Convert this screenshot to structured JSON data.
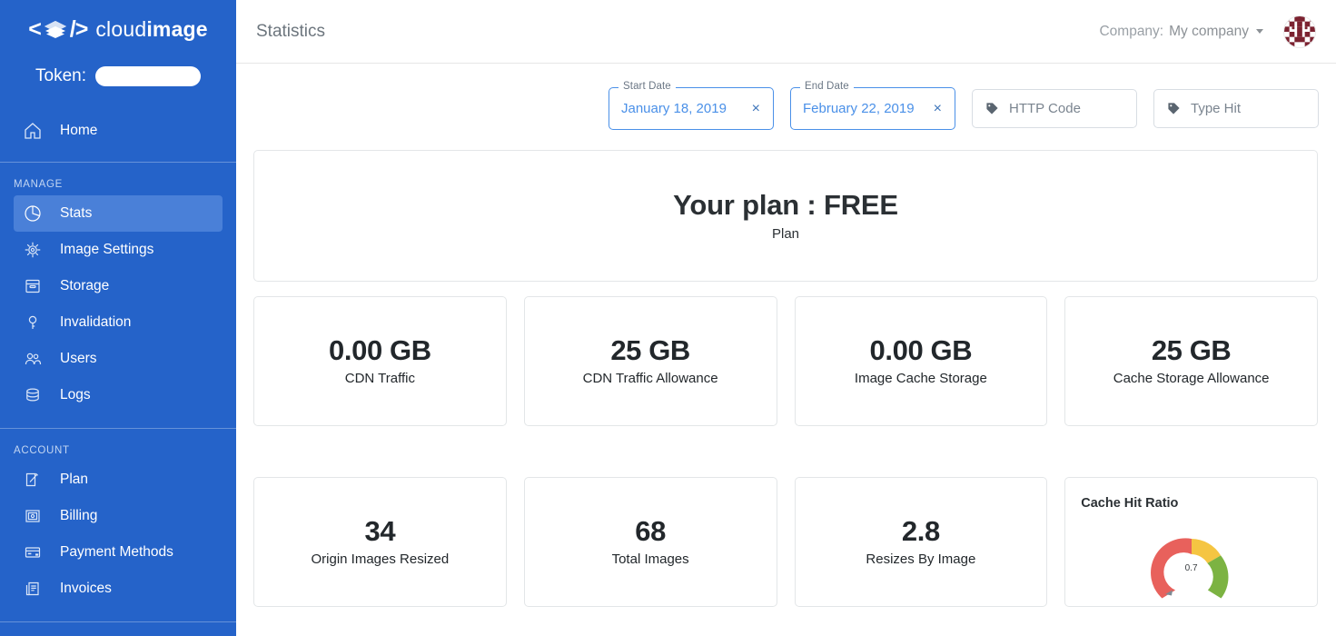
{
  "sidebar": {
    "brand": {
      "angle_open": "<",
      "angle_close": "/>",
      "name_light": "cloud",
      "name_bold": "image",
      "icon": "layers-icon"
    },
    "token": {
      "label": "Token:",
      "value": ""
    },
    "home": {
      "label": "Home",
      "icon": "home-icon"
    },
    "groups": [
      {
        "label": "MANAGE",
        "items": [
          {
            "label": "Stats",
            "icon": "pie-chart-icon",
            "active": true
          },
          {
            "label": "Image Settings",
            "icon": "gear-icon",
            "active": false
          },
          {
            "label": "Storage",
            "icon": "box-icon",
            "active": false
          },
          {
            "label": "Invalidation",
            "icon": "key-icon",
            "active": false
          },
          {
            "label": "Users",
            "icon": "users-icon",
            "active": false
          },
          {
            "label": "Logs",
            "icon": "database-icon",
            "active": false
          }
        ]
      },
      {
        "label": "ACCOUNT",
        "items": [
          {
            "label": "Plan",
            "icon": "edit-square-icon",
            "active": false
          },
          {
            "label": "Billing",
            "icon": "billing-icon",
            "active": false
          },
          {
            "label": "Payment Methods",
            "icon": "credit-card-icon",
            "active": false
          },
          {
            "label": "Invoices",
            "icon": "invoice-icon",
            "active": false
          }
        ]
      }
    ]
  },
  "header": {
    "title": "Statistics",
    "company_label": "Company:",
    "company_value": "My company",
    "caret_icon": "chevron-down-icon",
    "avatar_icon": "identicon-avatar"
  },
  "filters": {
    "start_date": {
      "legend": "Start Date",
      "value": "January 18, 2019",
      "clear": "×"
    },
    "end_date": {
      "legend": "End Date",
      "value": "February 22, 2019",
      "clear": "×"
    },
    "http_code": {
      "placeholder": "HTTP Code",
      "icon": "tag-icon"
    },
    "type_hit": {
      "placeholder": "Type Hit",
      "icon": "tag-icon"
    }
  },
  "plan_card": {
    "title": "Your plan : FREE",
    "subtitle": "Plan"
  },
  "stats_row1": [
    {
      "value": "0.00 GB",
      "label": "CDN Traffic"
    },
    {
      "value": "25 GB",
      "label": "CDN Traffic Allowance"
    },
    {
      "value": "0.00 GB",
      "label": "Image Cache Storage"
    },
    {
      "value": "25 GB",
      "label": "Cache Storage Allowance"
    }
  ],
  "stats_row2": [
    {
      "value": "34",
      "label": "Origin Images Resized"
    },
    {
      "value": "68",
      "label": "Total Images"
    },
    {
      "value": "2.8",
      "label": "Resizes By Image"
    }
  ],
  "chart_data": {
    "type": "pie",
    "title": "Cache Hit Ratio",
    "value_label": "0.7",
    "value": 0.7,
    "needle_value": 0.02,
    "min": 0,
    "max": 1,
    "segments": [
      {
        "name": "low",
        "from": 0,
        "to": 0.4,
        "color": "#e8615c"
      },
      {
        "name": "medium",
        "from": 0.4,
        "to": 0.7,
        "color": "#f5c542"
      },
      {
        "name": "high",
        "from": 0.7,
        "to": 1,
        "color": "#7cb342"
      }
    ],
    "xlabel": "",
    "ylabel": ""
  },
  "colors": {
    "sidebar_blue": "#2563c9",
    "sidebar_active": "#4a80d8",
    "accent_blue": "#4a90e8",
    "text_dark": "#22272b",
    "muted": "#6c757d",
    "gauge_red": "#e8615c",
    "gauge_yellow": "#f5c542",
    "gauge_green": "#7cb342",
    "avatar_maroon": "#7b2230"
  }
}
